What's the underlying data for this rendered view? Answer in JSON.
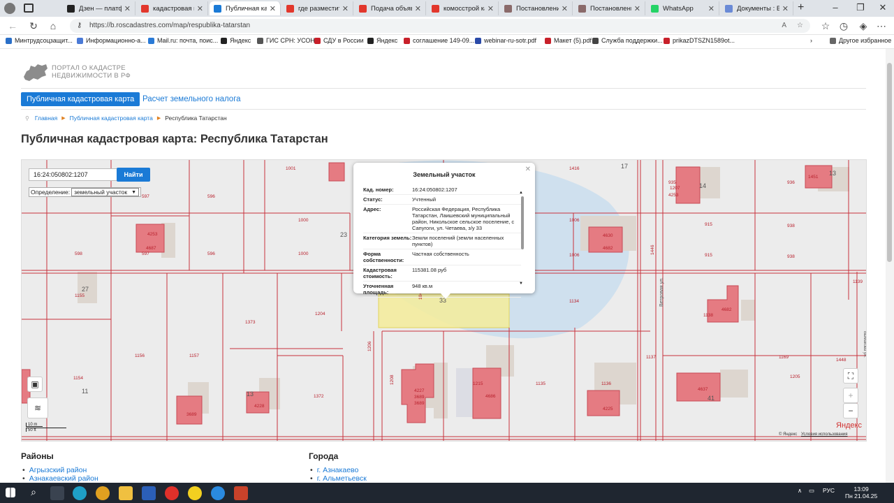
{
  "tabs": [
    {
      "label": "Дзен — платформ",
      "color": "#222"
    },
    {
      "label": "кадастровая карт",
      "color": "#e2372c"
    },
    {
      "label": "Публичная кадаст",
      "color": "#1a7ad6",
      "active": true
    },
    {
      "label": "где разместить о",
      "color": "#e2372c"
    },
    {
      "label": "Подача объявлен",
      "color": "#e2372c"
    },
    {
      "label": "комосстрой каза",
      "color": "#e2372c"
    },
    {
      "label": "Постановление К",
      "color": "#8a6a6a"
    },
    {
      "label": "Постановление К",
      "color": "#8a6a6a"
    },
    {
      "label": "WhatsApp",
      "color": "#25d366"
    },
    {
      "label": "Документы : Все",
      "color": "#6a8ad6"
    }
  ],
  "url": "https://b.roscadastres.com/map/respublika-tatarstan",
  "bookmarks": [
    "Минтрудсоцзащит...",
    "Информационно-а...",
    "Mail.ru: почта, поис...",
    "Яндекс",
    "ГИС СРН: УСОН",
    "СДУ в России",
    "Яндекс",
    "соглашение 149-09...",
    "webinar-ru-sotr.pdf",
    "Макет (5).pdf",
    "Служба поддержки...",
    "prikazDTSZN1589ot...",
    "Другое избранное"
  ],
  "site": {
    "logo_line1": "ПОРТАЛ О КАДАСТРЕ",
    "logo_line2": "НЕДВИЖИМОСТИ В РФ",
    "nav_map": "Публичная кадастровая карта",
    "nav_tax": "Расчет земельного налога",
    "crumb_home": "Главная",
    "crumb_map": "Публичная кадастровая карта",
    "crumb_current": "Республика Татарстан",
    "page_title": "Публичная кадастровая карта: Республика Татарстан"
  },
  "map": {
    "search_value": "16:24:050802:1207",
    "find_label": "Найти",
    "def_label": "Определение:",
    "def_value": "земельный участок",
    "scale_m": "10 m",
    "scale_ft": "50 ft",
    "attribution": "© Яндекс",
    "terms": "Условия использования",
    "yandex": "Яндекс",
    "street1": "Ветровая ул.",
    "street2": "Вымакова ул.",
    "labels": [
      "1001",
      "597",
      "596",
      "1000",
      "23",
      "598",
      "597",
      "596",
      "1000",
      "1416",
      "17",
      "1006",
      "1006",
      "915",
      "915",
      "938",
      "938",
      "936",
      "935",
      "14",
      "13",
      "27",
      "1155",
      "1373",
      "1204",
      "1134",
      "1138",
      "1156",
      "1157",
      "1206",
      "1208",
      "1215",
      "1135",
      "1136",
      "1137",
      "1169",
      "1448",
      "1154",
      "11",
      "13",
      "1372",
      "1205",
      "41",
      "1139",
      "1446",
      "1044",
      "33",
      "1207",
      "4253",
      "4253",
      "4687",
      "4630",
      "4682",
      "4682",
      "4637",
      "4686",
      "4225",
      "4228",
      "4227",
      "3689",
      "3689",
      "3689",
      "1451",
      "4232"
    ]
  },
  "popup": {
    "title": "Земельный участок",
    "rows": [
      {
        "k": "Кад. номер:",
        "v": "16:24:050802:1207"
      },
      {
        "k": "Статус:",
        "v": "Учтенный"
      },
      {
        "k": "Адрес:",
        "v": "Российская Федерация, Республика Татарстан, Лаишевский муниципальный район, Никольское сельское поселение, с Сапугоги, ул. Четаева, з/у 33"
      },
      {
        "k": "Категория земель:",
        "v": "Земли поселений (земли населенных пунктов)"
      },
      {
        "k": "Форма собственности:",
        "v": "Частная собственность"
      },
      {
        "k": "Кадастровая стоимость:",
        "v": "115381.08 руб"
      },
      {
        "k": "Уточненная площадь:",
        "v": "948 кв.м"
      }
    ]
  },
  "bottom": {
    "districts_title": "Районы",
    "districts": [
      "Агрызский район",
      "Азнакаевский район"
    ],
    "cities_title": "Города",
    "cities": [
      "г. Азнакаево",
      "г. Альметьевск"
    ]
  },
  "taskbar": {
    "lang": "РУС",
    "time": "13:09",
    "date": "Пн 21.04.25"
  }
}
